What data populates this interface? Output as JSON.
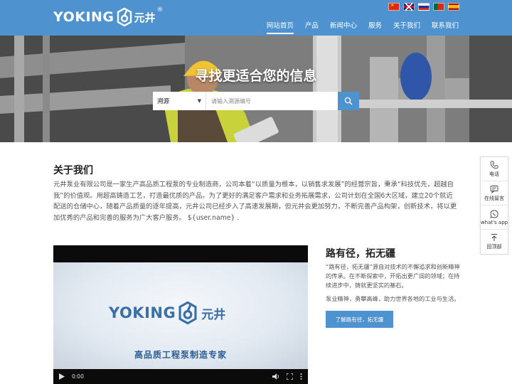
{
  "brand": {
    "logo_text": "YOKING",
    "logo_cn": "元井",
    "logo_reg": "®"
  },
  "languages": [
    "chinese-flag",
    "uk-flag",
    "russia-flag",
    "portugal-flag",
    "spain-flag"
  ],
  "nav": {
    "items": [
      {
        "label": "网站首页",
        "active": true
      },
      {
        "label": "产品",
        "active": false
      },
      {
        "label": "新闻中心",
        "active": false
      },
      {
        "label": "服务",
        "active": false
      },
      {
        "label": "关于我们",
        "active": false
      },
      {
        "label": "联系我们",
        "active": false
      }
    ]
  },
  "hero": {
    "title": "寻找更适合您的信息",
    "search": {
      "select_value": "溯源",
      "placeholder": "请输入溯源编号"
    }
  },
  "about": {
    "title": "关于我们",
    "text": "元井泵业有限公司是一家生产高品质工程泵的专业制造商，公司本着“以质量为根本，以销售求发展”的经营宗旨，秉承“科技优先，超越自我”的价值观。用超高铸造工艺，打造最优质的产品。为了更好的满足客户需求和业务拓展需求，公司计划在全国6大区域，建立20个就近配送的仓储中心，随着产品质量的逐年提高，元井公司已经步入了高速发展期，但元井会更加努力，不断完善产品构架，创新技术，将以更加优秀的产品和完善的服务为广大客户服务。 ${user.name} ."
  },
  "video": {
    "logo_text": "YOKING",
    "logo_cn": "元井",
    "tagline": "高品质工程泵制造专家",
    "time": "0:00"
  },
  "feature": {
    "title": "路有径，拓无疆",
    "p1": "“路有径，拓无疆”源自对技术的不懈追求和创新精神的传承。在不断探索中，开拓出更广阔的领域；在持续进步中，铸就更坚实的基石。",
    "p2": "泵业精神，勇攀高峰，助力世界各地的工业与生活。",
    "button": "了解路有径，拓无疆"
  },
  "side_float": {
    "items": [
      {
        "label": "电话",
        "icon": "phone-icon"
      },
      {
        "label": "在线留言",
        "icon": "message-icon"
      },
      {
        "label": "what's app",
        "icon": "whatsapp-icon"
      },
      {
        "label": "回顶部",
        "icon": "back-to-top-icon"
      }
    ]
  },
  "colors": {
    "primary": "#4e92cf",
    "text": "#555555",
    "title": "#222222"
  }
}
